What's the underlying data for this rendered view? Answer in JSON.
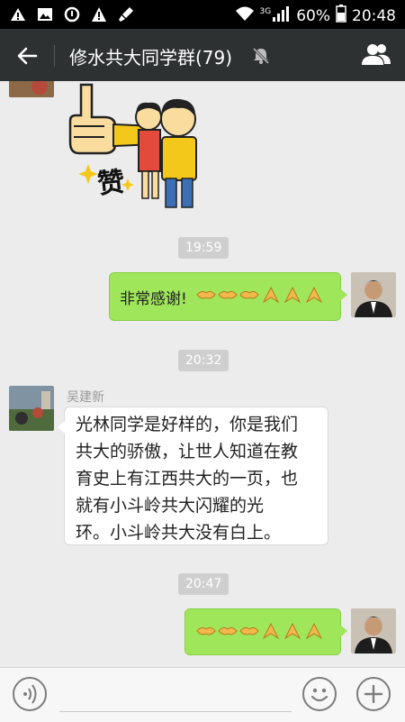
{
  "status_bar": {
    "battery": "60%",
    "time": "20:48",
    "network": "3G"
  },
  "header": {
    "title": "修水共大同学群(79)"
  },
  "messages": {
    "time1": "19:59",
    "msg1_text": "非常感谢!",
    "time2": "20:32",
    "msg2_sender": "吴建新",
    "msg2_lines": [
      "光林同学是好样的，你是我们",
      "共大的骄傲，让世人知道在教",
      "育史上有江西共大的一页，也",
      "就有小斗岭共大闪耀的光",
      "环。小斗岭共大没有白上。"
    ],
    "time3": "20:47",
    "sticker_caption": "赞"
  },
  "colors": {
    "sent_bubble": "#9fe65a",
    "title_bar": "#2e3132",
    "background": "#ececec"
  },
  "icons": [
    "back-arrow",
    "mute-bell",
    "group-members",
    "voice",
    "emoji",
    "plus"
  ]
}
